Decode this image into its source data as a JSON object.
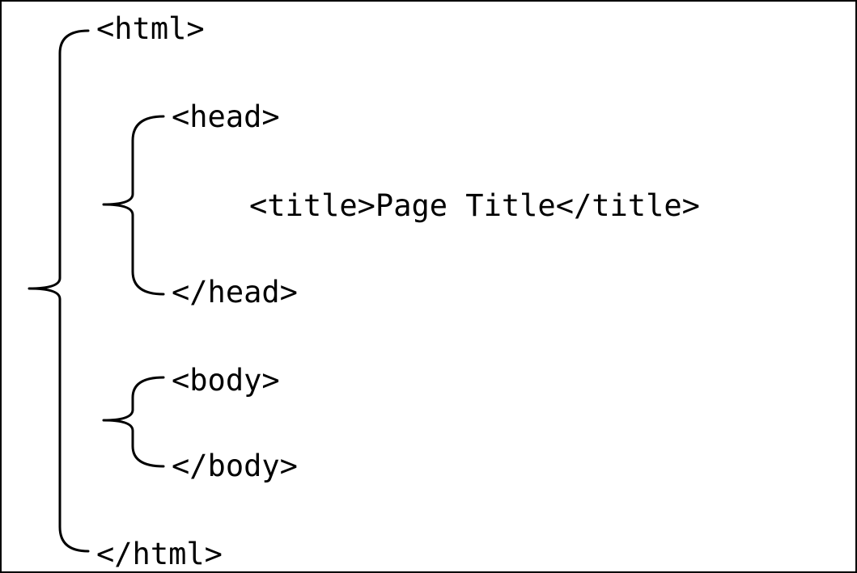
{
  "lines": {
    "html_open": "<html>",
    "head_open": "<head>",
    "title_element": "<title>Page Title</title>",
    "head_close": "</head>",
    "body_open": "<body>",
    "body_close": "</body>",
    "html_close": "</html>"
  },
  "colors": {
    "ink": "#000000",
    "background": "#ffffff"
  }
}
